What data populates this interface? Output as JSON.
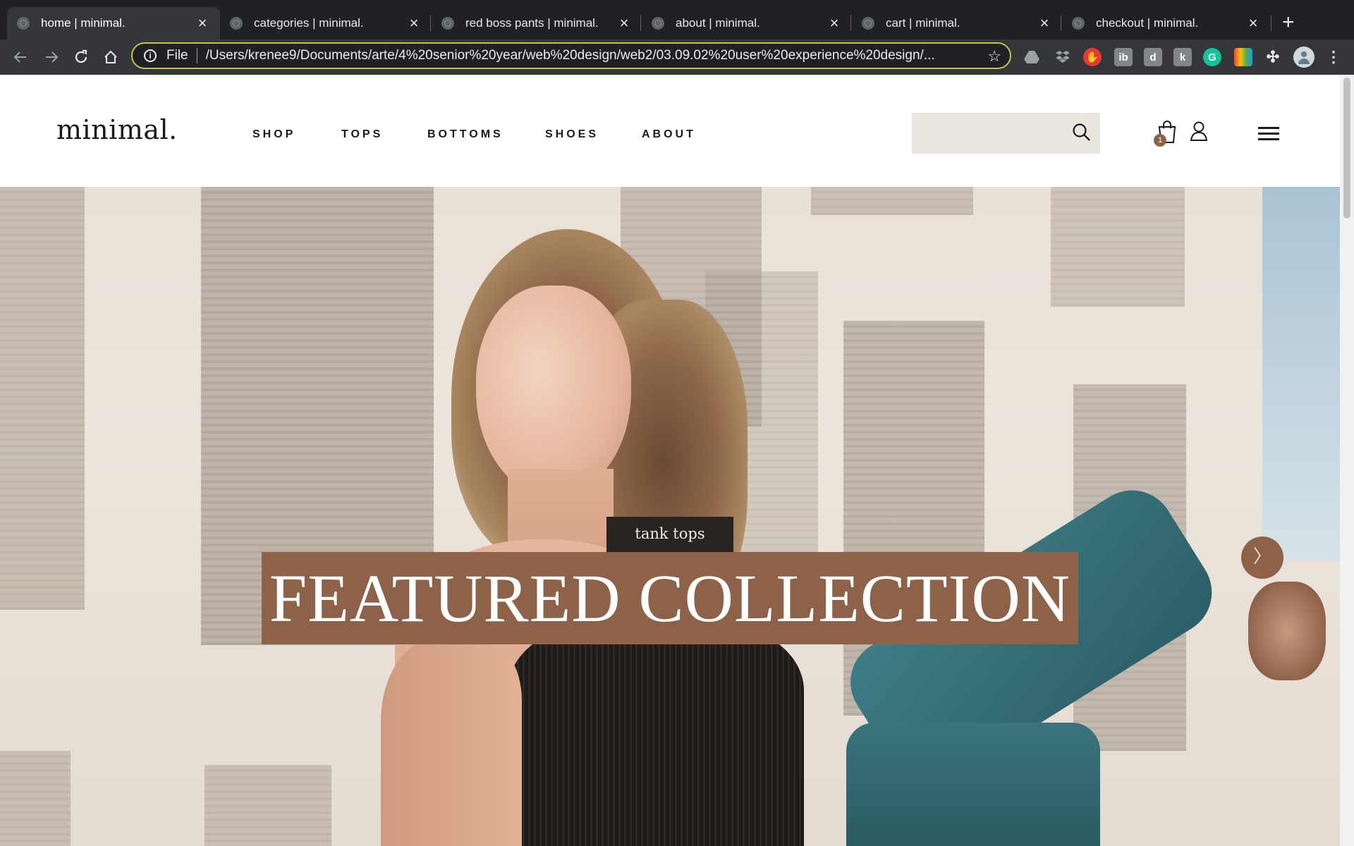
{
  "browser": {
    "tabs": [
      {
        "title": "home | minimal.",
        "active": true
      },
      {
        "title": "categories | minimal.",
        "active": false
      },
      {
        "title": "red boss pants | minimal.",
        "active": false
      },
      {
        "title": "about | minimal.",
        "active": false
      },
      {
        "title": "cart | minimal.",
        "active": false
      },
      {
        "title": "checkout | minimal.",
        "active": false
      }
    ],
    "new_tab": "+",
    "omnibox": {
      "scheme": "File",
      "url": "/Users/krenee9/Documents/arte/4%20senior%20year/web%20design/web2/03.09.02%20user%20experience%20design/..."
    },
    "extensions": [
      "drive-icon",
      "dropbox-icon",
      "adblock-icon",
      "ib-icon",
      "d-icon",
      "k-icon",
      "grammarly-icon",
      "color-icon",
      "puzzle-icon"
    ],
    "extension_labels": {
      "ib": "ib",
      "d": "d",
      "k": "k",
      "g": "G"
    }
  },
  "site": {
    "logo": "minimal.",
    "nav": [
      "SHOP",
      "TOPS",
      "BOTTOMS",
      "SHOES",
      "ABOUT"
    ],
    "search": {
      "placeholder": ""
    },
    "cart_count": "1"
  },
  "hero": {
    "category_tag": "tank tops",
    "title": "FEATURED COLLECTION",
    "next_arrow": "〉"
  },
  "colors": {
    "accent": "#8e6248",
    "tag_bg": "#272422",
    "search_bg": "#eae7e1",
    "chrome_dark": "#202124",
    "chrome_toolbar": "#35363a"
  }
}
